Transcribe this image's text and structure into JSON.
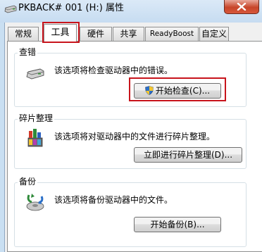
{
  "window": {
    "title": "PKBACK# 001 (H:) 属性",
    "close_glyph": "✕"
  },
  "tabs": [
    {
      "label": "常规"
    },
    {
      "label": "工具",
      "active": true
    },
    {
      "label": "硬件"
    },
    {
      "label": "共享"
    },
    {
      "label": "ReadyBoost"
    },
    {
      "label": "自定义"
    }
  ],
  "sections": {
    "error_check": {
      "title": "查错",
      "description": "该选项将检查驱动器中的错误。",
      "button": "开始检查(C)...",
      "icon": "drive-icon"
    },
    "defrag": {
      "title": "碎片整理",
      "description": "该选项将对驱动器中的文件进行碎片整理。",
      "button": "立即进行碎片整理(D)...",
      "icon": "defrag-icon"
    },
    "backup": {
      "title": "备份",
      "description": "该选项将备份驱动器中的文件。",
      "button": "开始备份(B)...",
      "icon": "backup-icon"
    }
  },
  "colors": {
    "highlight": "#c8141c",
    "titlebar": "#c6dcf1"
  }
}
